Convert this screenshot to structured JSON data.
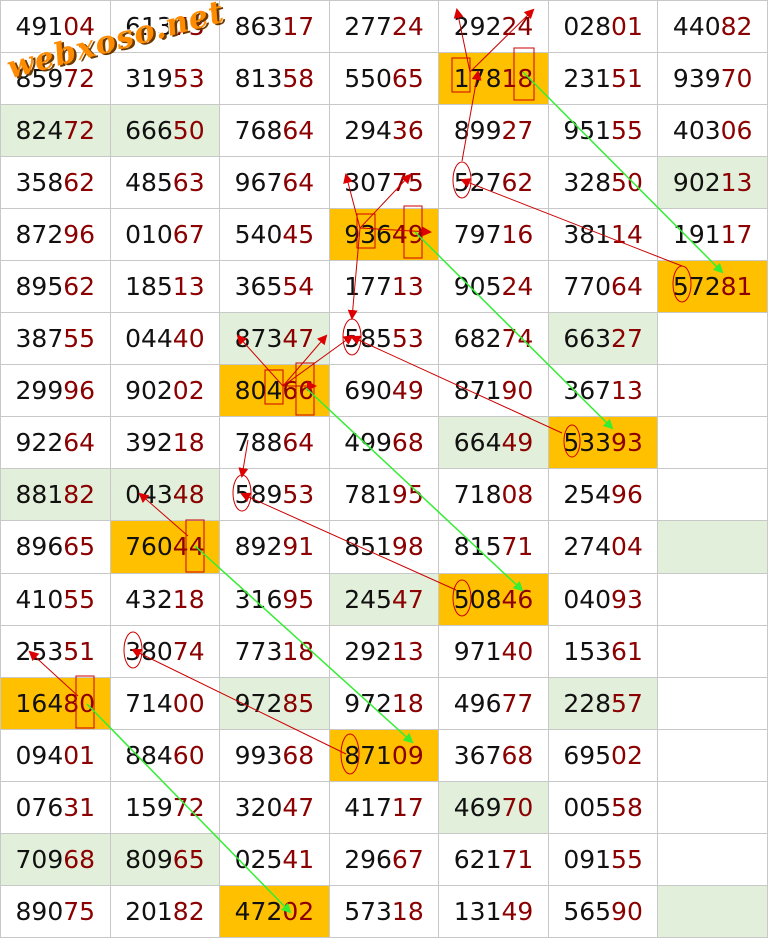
{
  "logo": "webxoso.net",
  "colors": {
    "green_cell": "#e2efda",
    "orange_cell": "#ffc000",
    "tail_digits": "#8b0000",
    "green_arrow": "#33ee33",
    "red_arrow": "#cc0000"
  },
  "rows": [
    [
      {
        "v": "49104"
      },
      {
        "v": "61373"
      },
      {
        "v": "86317"
      },
      {
        "v": "27724"
      },
      {
        "v": "29224"
      },
      {
        "v": "02801"
      },
      {
        "v": "44082"
      }
    ],
    [
      {
        "v": "85972"
      },
      {
        "v": "31953"
      },
      {
        "v": "81358"
      },
      {
        "v": "55065"
      },
      {
        "v": "17818",
        "bg": "o"
      },
      {
        "v": "23151"
      },
      {
        "v": "93970"
      }
    ],
    [
      {
        "v": "82472",
        "bg": "g"
      },
      {
        "v": "66650",
        "bg": "g"
      },
      {
        "v": "76864"
      },
      {
        "v": "29436"
      },
      {
        "v": "89927"
      },
      {
        "v": "95155"
      },
      {
        "v": "40306"
      }
    ],
    [
      {
        "v": "35862"
      },
      {
        "v": "48563"
      },
      {
        "v": "96764"
      },
      {
        "v": "30775"
      },
      {
        "v": "52762"
      },
      {
        "v": "32850"
      },
      {
        "v": "90213",
        "bg": "g"
      }
    ],
    [
      {
        "v": "87296"
      },
      {
        "v": "01067"
      },
      {
        "v": "54045"
      },
      {
        "v": "93649",
        "bg": "o"
      },
      {
        "v": "79716"
      },
      {
        "v": "38114"
      },
      {
        "v": "19117"
      }
    ],
    [
      {
        "v": "89562"
      },
      {
        "v": "18513"
      },
      {
        "v": "36554"
      },
      {
        "v": "17713"
      },
      {
        "v": "90524"
      },
      {
        "v": "77064"
      },
      {
        "v": "57281",
        "bg": "o"
      }
    ],
    [
      {
        "v": "38755"
      },
      {
        "v": "04440"
      },
      {
        "v": "87347",
        "bg": "g"
      },
      {
        "v": "58553"
      },
      {
        "v": "68274"
      },
      {
        "v": "66327",
        "bg": "g"
      },
      {
        "v": ""
      }
    ],
    [
      {
        "v": "29996"
      },
      {
        "v": "90202"
      },
      {
        "v": "80466",
        "bg": "o"
      },
      {
        "v": "69049"
      },
      {
        "v": "87190"
      },
      {
        "v": "36713"
      },
      {
        "v": ""
      }
    ],
    [
      {
        "v": "92264"
      },
      {
        "v": "39218"
      },
      {
        "v": "78864"
      },
      {
        "v": "49968"
      },
      {
        "v": "66449",
        "bg": "g"
      },
      {
        "v": "53393",
        "bg": "o"
      },
      {
        "v": ""
      }
    ],
    [
      {
        "v": "88182",
        "bg": "g"
      },
      {
        "v": "04348",
        "bg": "g"
      },
      {
        "v": "58953"
      },
      {
        "v": "78195"
      },
      {
        "v": "71808"
      },
      {
        "v": "25496"
      },
      {
        "v": ""
      }
    ],
    [
      {
        "v": "89665"
      },
      {
        "v": "76044",
        "bg": "o"
      },
      {
        "v": "89291"
      },
      {
        "v": "85198"
      },
      {
        "v": "81571"
      },
      {
        "v": "27404"
      },
      {
        "v": "",
        "bg": "g"
      }
    ],
    [
      {
        "v": "41055"
      },
      {
        "v": "43218"
      },
      {
        "v": "31695"
      },
      {
        "v": "24547",
        "bg": "g"
      },
      {
        "v": "50846",
        "bg": "o"
      },
      {
        "v": "04093"
      },
      {
        "v": ""
      }
    ],
    [
      {
        "v": "25351"
      },
      {
        "v": "38074"
      },
      {
        "v": "77318"
      },
      {
        "v": "29213"
      },
      {
        "v": "97140"
      },
      {
        "v": "15361"
      },
      {
        "v": ""
      }
    ],
    [
      {
        "v": "16480",
        "bg": "o"
      },
      {
        "v": "71400"
      },
      {
        "v": "97285",
        "bg": "g"
      },
      {
        "v": "97218"
      },
      {
        "v": "49677"
      },
      {
        "v": "22857",
        "bg": "g"
      },
      {
        "v": ""
      }
    ],
    [
      {
        "v": "09401"
      },
      {
        "v": "88460"
      },
      {
        "v": "99368"
      },
      {
        "v": "87109",
        "bg": "o"
      },
      {
        "v": "36768"
      },
      {
        "v": "69502"
      },
      {
        "v": ""
      }
    ],
    [
      {
        "v": "07631"
      },
      {
        "v": "15972"
      },
      {
        "v": "32047"
      },
      {
        "v": "41717"
      },
      {
        "v": "46970",
        "bg": "g"
      },
      {
        "v": "00558"
      },
      {
        "v": ""
      }
    ],
    [
      {
        "v": "70968",
        "bg": "g"
      },
      {
        "v": "80965",
        "bg": "g"
      },
      {
        "v": "02541"
      },
      {
        "v": "29667"
      },
      {
        "v": "62171"
      },
      {
        "v": "09155"
      },
      {
        "v": ""
      }
    ],
    [
      {
        "v": "89075"
      },
      {
        "v": "20182"
      },
      {
        "v": "47202",
        "bg": "o"
      },
      {
        "v": "57318"
      },
      {
        "v": "13149"
      },
      {
        "v": "56590"
      },
      {
        "v": "",
        "bg": "g"
      }
    ]
  ]
}
